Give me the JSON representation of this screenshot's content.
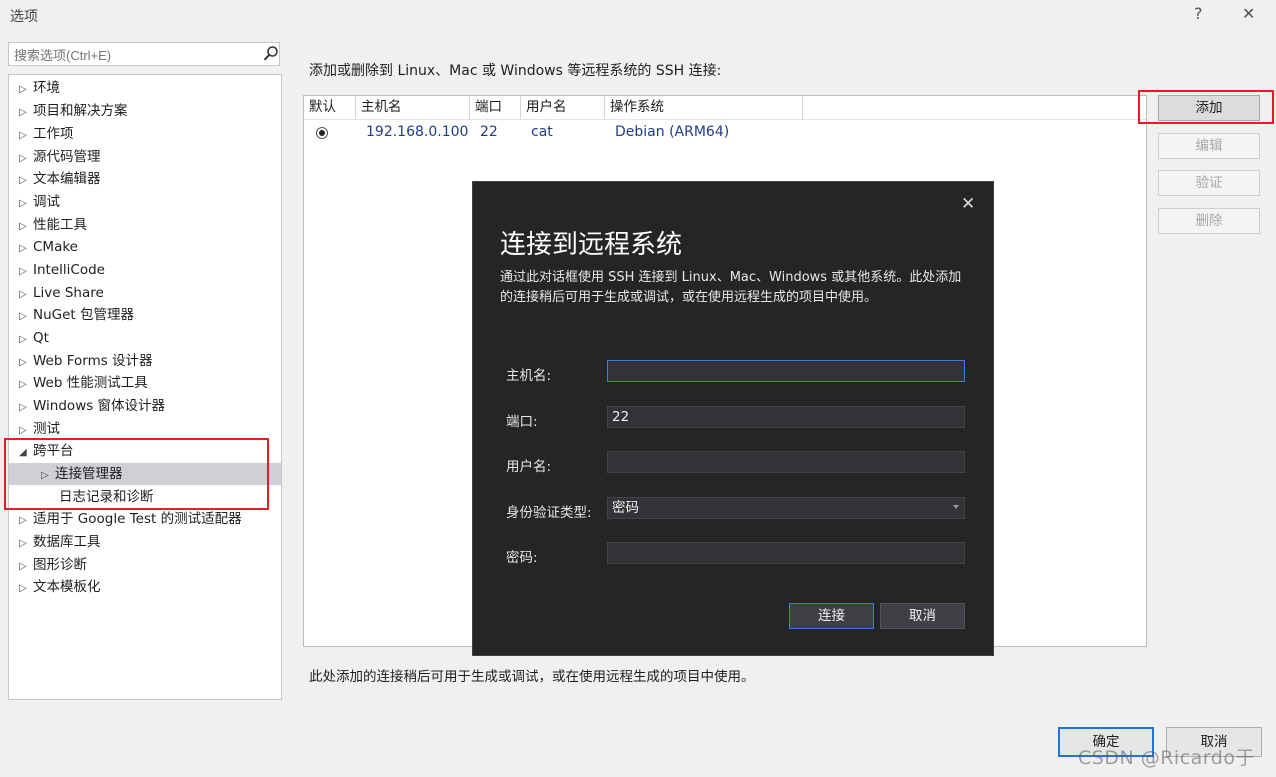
{
  "window": {
    "title": "选项",
    "help_label": "?",
    "close_label": "✕"
  },
  "search": {
    "placeholder": "搜索选项(Ctrl+E)"
  },
  "tree": {
    "items": [
      {
        "label": "环境",
        "arrow": "▷"
      },
      {
        "label": "项目和解决方案",
        "arrow": "▷"
      },
      {
        "label": "工作项",
        "arrow": "▷"
      },
      {
        "label": "源代码管理",
        "arrow": "▷"
      },
      {
        "label": "文本编辑器",
        "arrow": "▷"
      },
      {
        "label": "调试",
        "arrow": "▷"
      },
      {
        "label": "性能工具",
        "arrow": "▷"
      },
      {
        "label": "CMake",
        "arrow": "▷"
      },
      {
        "label": "IntelliCode",
        "arrow": "▷"
      },
      {
        "label": "Live Share",
        "arrow": "▷"
      },
      {
        "label": "NuGet 包管理器",
        "arrow": "▷"
      },
      {
        "label": "Qt",
        "arrow": "▷"
      },
      {
        "label": "Web Forms 设计器",
        "arrow": "▷"
      },
      {
        "label": "Web 性能测试工具",
        "arrow": "▷"
      },
      {
        "label": "Windows 窗体设计器",
        "arrow": "▷"
      },
      {
        "label": "测试",
        "arrow": "▷"
      },
      {
        "label": "跨平台",
        "arrow": "◢"
      },
      {
        "label": "连接管理器",
        "arrow": "▷"
      },
      {
        "label": "日志记录和诊断",
        "arrow": ""
      },
      {
        "label": "适用于 Google Test 的测试适配器",
        "arrow": "▷"
      },
      {
        "label": "数据库工具",
        "arrow": "▷"
      },
      {
        "label": "图形诊断",
        "arrow": "▷"
      },
      {
        "label": "文本模板化",
        "arrow": "▷"
      }
    ]
  },
  "main": {
    "description": "添加或删除到 Linux、Mac 或 Windows 等远程系统的 SSH 连接:",
    "columns": [
      "默认",
      "主机名",
      "端口",
      "用户名",
      "操作系统"
    ],
    "rows": [
      {
        "host": "192.168.0.100",
        "port": "22",
        "user": "cat",
        "os": "Debian (ARM64)"
      }
    ],
    "footer_note": "此处添加的连接稍后可用于生成或调试，或在使用远程生成的项目中使用。"
  },
  "side_buttons": {
    "add": "添加",
    "edit": "编辑",
    "verify": "验证",
    "delete": "删除"
  },
  "dialog": {
    "close_label": "✕",
    "title": "连接到远程系统",
    "description": "通过此对话框使用 SSH 连接到 Linux、Mac、Windows 或其他系统。此处添加的连接稍后可用于生成或调试，或在使用远程生成的项目中使用。",
    "fields": {
      "host_label": "主机名:",
      "host_value": "",
      "port_label": "端口:",
      "port_value": "22",
      "user_label": "用户名:",
      "user_value": "",
      "auth_label": "身份验证类型:",
      "auth_value": "密码",
      "password_label": "密码:",
      "password_value": ""
    },
    "connect_label": "连接",
    "cancel_label": "取消"
  },
  "footer": {
    "ok_label": "确定",
    "cancel_label": "取消"
  },
  "watermark": "CSDN @Ricardo于",
  "colors": {
    "highlight_red": "#e31e26",
    "link_blue": "#1f3c8a",
    "dialog_bg": "#252526",
    "focus_blue": "#3b7ed8"
  }
}
